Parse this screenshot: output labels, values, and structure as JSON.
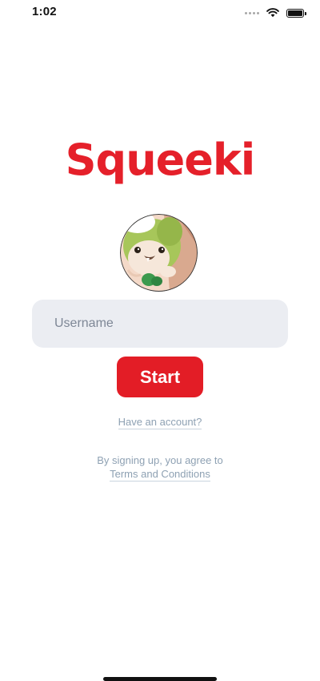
{
  "status_bar": {
    "time": "1:02",
    "icons": [
      "cellular-signal-icon",
      "wifi-icon",
      "battery-icon"
    ]
  },
  "brand": {
    "logo_text": "Squeeki",
    "mascot_icon": "mascot-avatar-icon",
    "accent_color": "#e5202a"
  },
  "form": {
    "username_placeholder": "Username",
    "username_value": "",
    "start_label": "Start"
  },
  "links": {
    "have_account": "Have an account?",
    "terms_prefix": "By signing up, you agree to",
    "terms_link": "Terms and Conditions"
  }
}
